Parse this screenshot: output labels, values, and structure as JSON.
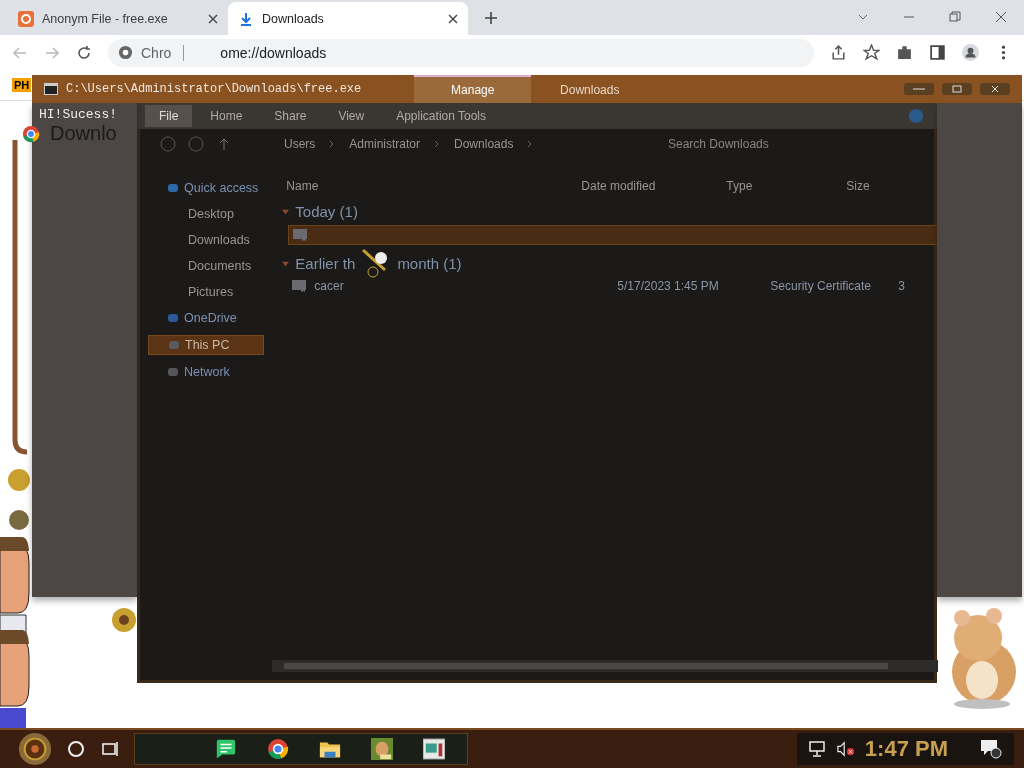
{
  "browser": {
    "tabs": [
      {
        "title": "Anonym File - free.exe",
        "selected": false
      },
      {
        "title": "Downloads",
        "selected": true
      }
    ],
    "address": {
      "prefix": "Chro",
      "url": "ome://downloads"
    },
    "bookmark_badge": "PH",
    "page_heading": "Downlo"
  },
  "explorer": {
    "ribbon_tabs": [
      {
        "label": "Manage",
        "selected": true
      },
      {
        "label": "Downloads",
        "selected": false
      }
    ],
    "menu": [
      {
        "label": "File",
        "selected": true
      },
      {
        "label": "Home",
        "selected": false
      },
      {
        "label": "Share",
        "selected": false
      },
      {
        "label": "View",
        "selected": false
      },
      {
        "label": "Application Tools",
        "selected": false
      }
    ],
    "breadcrumb": [
      "Users",
      "Administrator",
      "Downloads"
    ],
    "search": {
      "placeholder": "Search Downloads"
    },
    "nav": [
      {
        "label": "Quick access",
        "kind": "star",
        "selected": false,
        "children": [
          {
            "label": "Desktop",
            "selected": false
          },
          {
            "label": "Downloads",
            "selected": false
          },
          {
            "label": "Documents",
            "selected": false
          },
          {
            "label": "Pictures",
            "selected": false
          }
        ]
      },
      {
        "label": "OneDrive",
        "kind": "cloud",
        "selected": false
      },
      {
        "label": "This PC",
        "kind": "pc",
        "selected": true
      },
      {
        "label": "Network",
        "kind": "network",
        "selected": false
      }
    ],
    "columns": [
      "Name",
      "Date modified",
      "Type",
      "Size"
    ],
    "groups": [
      {
        "label": "Today (1)",
        "expanded": true,
        "rows": [
          {
            "selected": true
          }
        ]
      },
      {
        "label": "Earlier th",
        "label_end": "month (1)",
        "expanded": true,
        "rows": [
          {
            "selected": false,
            "name": "cacer",
            "date": "5/17/2023 1:45 PM",
            "type": "Security Certificate",
            "size": "3"
          }
        ]
      }
    ]
  },
  "console": {
    "title": "C:\\Users\\Administrator\\Downloads\\free.exe",
    "output": "HI!Sucess!"
  },
  "taskbar": {
    "time": "1:47 PM"
  }
}
